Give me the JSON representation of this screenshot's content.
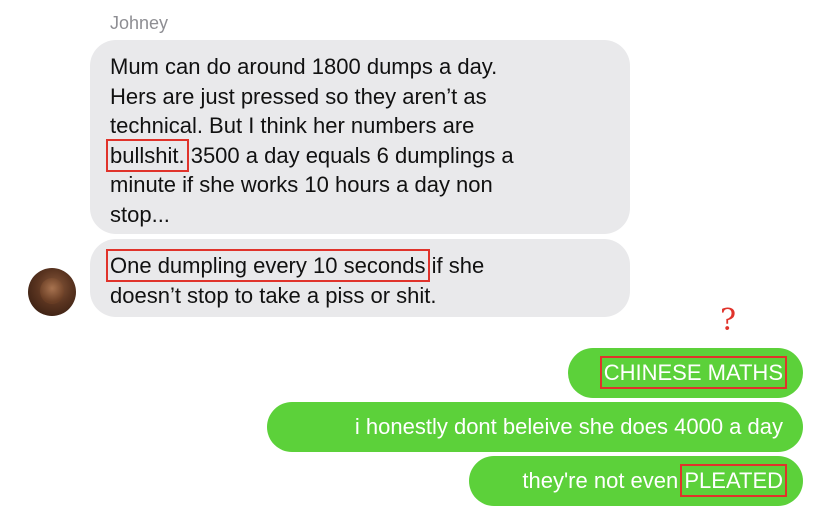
{
  "sender": {
    "name": "Johney"
  },
  "incoming": [
    {
      "lines": [
        "Mum can do around 1800 dumps a day.",
        "Hers are just pressed so they aren’t as",
        "technical. But I think her numbers are",
        {
          "highlight": "bullshit.",
          "rest": " 3500 a day equals 6 dumplings a"
        },
        "minute if she works 10 hours a day non",
        "stop..."
      ]
    },
    {
      "lines": [
        {
          "highlight": "One dumpling every 10 seconds",
          "rest": " if she"
        },
        "doesn’t stop to take a piss or shit."
      ]
    }
  ],
  "annotation": {
    "mark": "?"
  },
  "outgoing": [
    {
      "prefix": "",
      "highlight": "CHINESE MATHS"
    },
    {
      "text": "i honestly dont beleive she does 4000 a day"
    },
    {
      "prefix": "they're not even ",
      "highlight": "PLEATED"
    }
  ],
  "colors": {
    "incoming_bubble": "#e9e9eb",
    "outgoing_bubble": "#5cd13a",
    "highlight_box": "#e0332b"
  }
}
